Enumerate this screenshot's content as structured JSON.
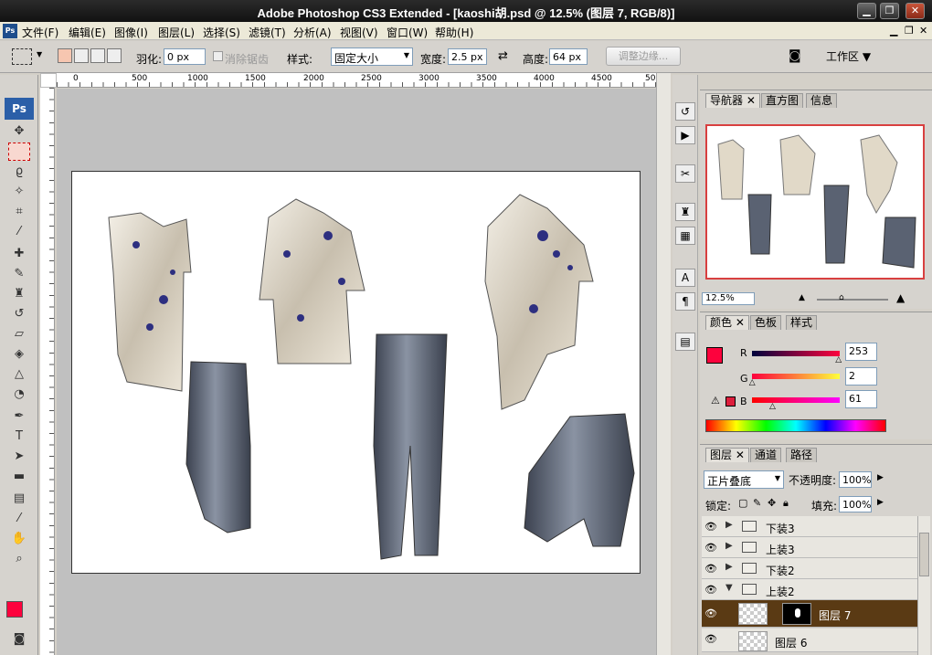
{
  "title_bar": {
    "title": "Adobe Photoshop CS3 Extended - [kaoshi胡.psd @ 12.5% (图层 7, RGB/8)]"
  },
  "menu": {
    "items": [
      "文件(F)",
      "编辑(E)",
      "图像(I)",
      "图层(L)",
      "选择(S)",
      "滤镜(T)",
      "分析(A)",
      "视图(V)",
      "窗口(W)",
      "帮助(H)"
    ]
  },
  "options": {
    "feather_label": "羽化:",
    "feather_value": "0 px",
    "antialias_label": "消除锯齿",
    "style_label": "样式:",
    "style_value": "固定大小",
    "width_label": "宽度:",
    "width_value": "2.5 px",
    "height_label": "高度:",
    "height_value": "64 px",
    "refine_edge_label": "调整边缘...",
    "workspace_label": "工作区 ▼"
  },
  "ruler": {
    "h_ticks": [
      "0",
      "500",
      "1000",
      "1500",
      "2000",
      "2500",
      "3000",
      "3500",
      "4000",
      "4500",
      "50"
    ]
  },
  "navigator": {
    "tabs": [
      "导航器",
      "直方图",
      "信息"
    ],
    "zoom": "12.5%"
  },
  "color_panel": {
    "tabs": [
      "颜色",
      "色板",
      "样式"
    ],
    "r_label": "R",
    "g_label": "G",
    "b_label": "B",
    "r": "253",
    "g": "2",
    "b": "61",
    "r_fraction": 0.992,
    "g_fraction": 0.008,
    "b_fraction": 0.239,
    "foreground_color": "#fd023d"
  },
  "layers_panel": {
    "tabs": [
      "图层",
      "通道",
      "路径"
    ],
    "blend_mode": "正片叠底",
    "opacity_label": "不透明度:",
    "opacity": "100%",
    "lock_label": "锁定:",
    "fill_label": "填充:",
    "fill": "100%",
    "layers": [
      {
        "name": "下装3",
        "type": "group",
        "expanded": false
      },
      {
        "name": "上装3",
        "type": "group",
        "expanded": false
      },
      {
        "name": "下装2",
        "type": "group",
        "expanded": false
      },
      {
        "name": "上装2",
        "type": "group",
        "expanded": true
      },
      {
        "name": "图层 7",
        "type": "layer",
        "selected": true
      },
      {
        "name": "图层 6",
        "type": "layer",
        "selected": false
      }
    ]
  }
}
